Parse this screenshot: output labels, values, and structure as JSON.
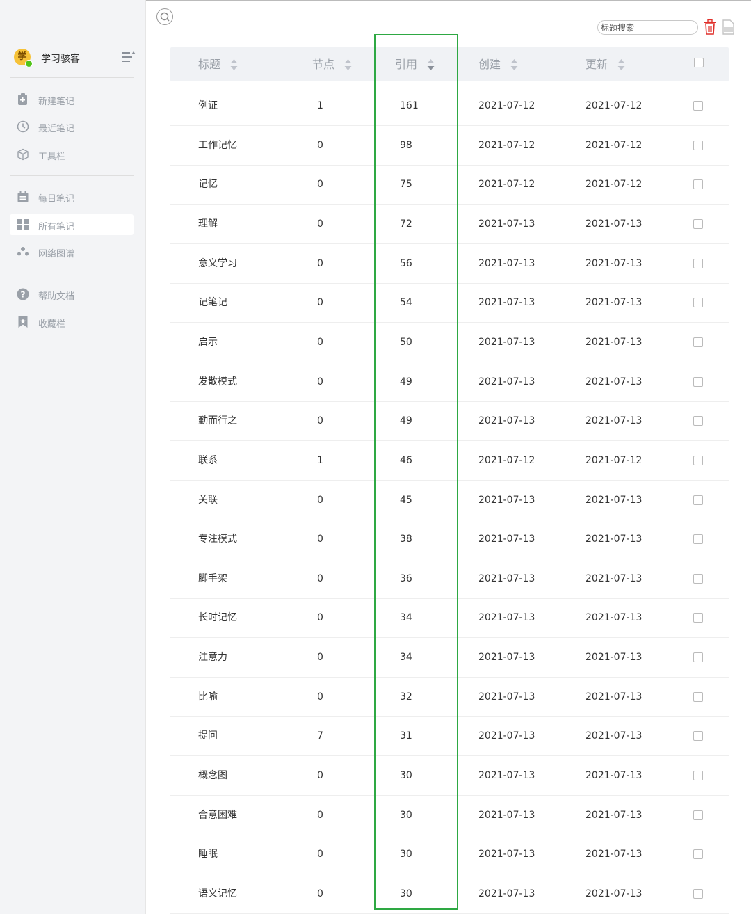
{
  "sidebar": {
    "user": {
      "avatar_text": "学",
      "name": "学习骇客"
    },
    "groups": [
      [
        {
          "label": "新建笔记",
          "icon": "new-note-icon"
        },
        {
          "label": "最近笔记",
          "icon": "clock-icon"
        },
        {
          "label": "工具栏",
          "icon": "cube-icon"
        }
      ],
      [
        {
          "label": "每日笔记",
          "icon": "calendar-icon"
        },
        {
          "label": "所有笔记",
          "icon": "grid-icon",
          "active": true
        },
        {
          "label": "网络图谱",
          "icon": "graph-icon"
        }
      ],
      [
        {
          "label": "帮助文档",
          "icon": "help-icon"
        },
        {
          "label": "收藏栏",
          "icon": "bookmark-icon"
        }
      ]
    ]
  },
  "toolbar": {
    "search_placeholder": "标题搜索"
  },
  "table": {
    "columns": [
      "标题",
      "节点",
      "引用",
      "创建",
      "更新"
    ],
    "rows": [
      {
        "title": "例证",
        "nodes": "1",
        "refs": "161",
        "created": "2021-07-12",
        "updated": "2021-07-12"
      },
      {
        "title": "工作记忆",
        "nodes": "0",
        "refs": "98",
        "created": "2021-07-12",
        "updated": "2021-07-12"
      },
      {
        "title": "记忆",
        "nodes": "0",
        "refs": "75",
        "created": "2021-07-12",
        "updated": "2021-07-12"
      },
      {
        "title": "理解",
        "nodes": "0",
        "refs": "72",
        "created": "2021-07-13",
        "updated": "2021-07-13"
      },
      {
        "title": "意义学习",
        "nodes": "0",
        "refs": "56",
        "created": "2021-07-13",
        "updated": "2021-07-13"
      },
      {
        "title": "记笔记",
        "nodes": "0",
        "refs": "54",
        "created": "2021-07-13",
        "updated": "2021-07-13"
      },
      {
        "title": "启示",
        "nodes": "0",
        "refs": "50",
        "created": "2021-07-13",
        "updated": "2021-07-13"
      },
      {
        "title": "发散模式",
        "nodes": "0",
        "refs": "49",
        "created": "2021-07-13",
        "updated": "2021-07-13"
      },
      {
        "title": "勤而行之",
        "nodes": "0",
        "refs": "49",
        "created": "2021-07-13",
        "updated": "2021-07-13"
      },
      {
        "title": "联系",
        "nodes": "1",
        "refs": "46",
        "created": "2021-07-12",
        "updated": "2021-07-12"
      },
      {
        "title": "关联",
        "nodes": "0",
        "refs": "45",
        "created": "2021-07-13",
        "updated": "2021-07-13"
      },
      {
        "title": "专注模式",
        "nodes": "0",
        "refs": "38",
        "created": "2021-07-13",
        "updated": "2021-07-13"
      },
      {
        "title": "脚手架",
        "nodes": "0",
        "refs": "36",
        "created": "2021-07-13",
        "updated": "2021-07-13"
      },
      {
        "title": "长时记忆",
        "nodes": "0",
        "refs": "34",
        "created": "2021-07-13",
        "updated": "2021-07-13"
      },
      {
        "title": "注意力",
        "nodes": "0",
        "refs": "34",
        "created": "2021-07-13",
        "updated": "2021-07-13"
      },
      {
        "title": "比喻",
        "nodes": "0",
        "refs": "32",
        "created": "2021-07-13",
        "updated": "2021-07-13"
      },
      {
        "title": "提问",
        "nodes": "7",
        "refs": "31",
        "created": "2021-07-13",
        "updated": "2021-07-13"
      },
      {
        "title": "概念图",
        "nodes": "0",
        "refs": "30",
        "created": "2021-07-13",
        "updated": "2021-07-13"
      },
      {
        "title": "合意困难",
        "nodes": "0",
        "refs": "30",
        "created": "2021-07-13",
        "updated": "2021-07-13"
      },
      {
        "title": "睡眠",
        "nodes": "0",
        "refs": "30",
        "created": "2021-07-13",
        "updated": "2021-07-13"
      },
      {
        "title": "语义记忆",
        "nodes": "0",
        "refs": "30",
        "created": "2021-07-13",
        "updated": "2021-07-13"
      }
    ]
  },
  "colors": {
    "highlight": "#2ea843",
    "trash": "#e0302b",
    "sidebar_bg": "#f3f4f6",
    "header_bg": "#f0f2f5"
  }
}
